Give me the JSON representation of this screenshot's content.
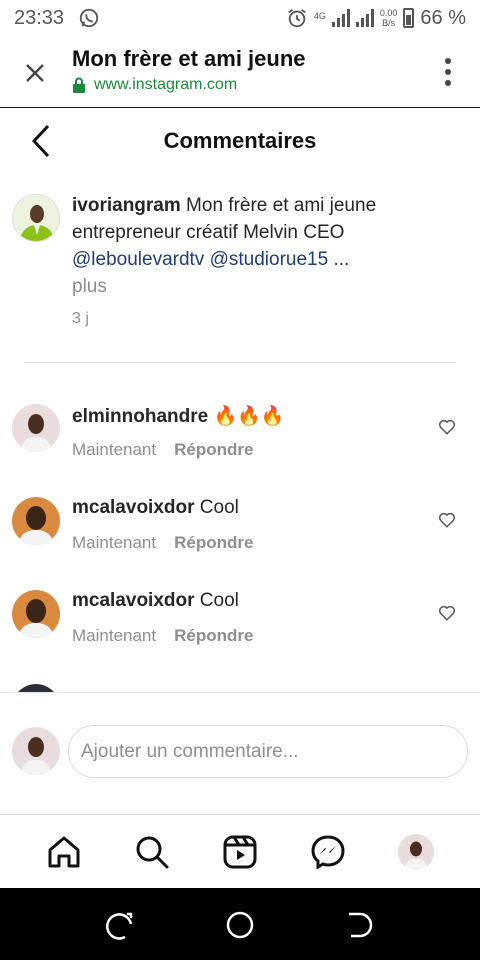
{
  "status_bar": {
    "time": "23:33",
    "network_type": "4G",
    "data_rate_value": "0.00",
    "data_rate_unit": "B/s",
    "battery": "66 %",
    "icons": [
      "whatsapp-icon",
      "alarm-icon",
      "signal-icon",
      "battery-icon"
    ]
  },
  "browser": {
    "title": "Mon frère et ami jeune",
    "url": "www.instagram.com",
    "url_color": "#1b8a3a"
  },
  "header": {
    "title": "Commentaires"
  },
  "caption": {
    "username": "ivoriangram",
    "text": " Mon frère et ami jeune entrepreneur créatif Melvin CEO ",
    "mention_1": "@leboulevardtv",
    "mention_2": "@studiorue15",
    "ellipsis": " ...",
    "more": "plus",
    "time": "3 j"
  },
  "comments": [
    {
      "username": "elminnohandre",
      "text": " 🔥🔥🔥",
      "time": "Maintenant",
      "reply": "Répondre"
    },
    {
      "username": "mcalavoixdor",
      "text": " Cool",
      "time": "Maintenant",
      "reply": "Répondre"
    },
    {
      "username": "mcalavoixdor",
      "text": " Cool",
      "time": "Maintenant",
      "reply": "Répondre"
    }
  ],
  "add_comment": {
    "placeholder": "Ajouter un commentaire..."
  },
  "bottom_nav": [
    "home-icon",
    "search-icon",
    "reels-icon",
    "messenger-icon",
    "profile-avatar"
  ],
  "colors": {
    "mention": "#1f3d7a",
    "muted": "#8e8e8e",
    "text": "#262626"
  }
}
